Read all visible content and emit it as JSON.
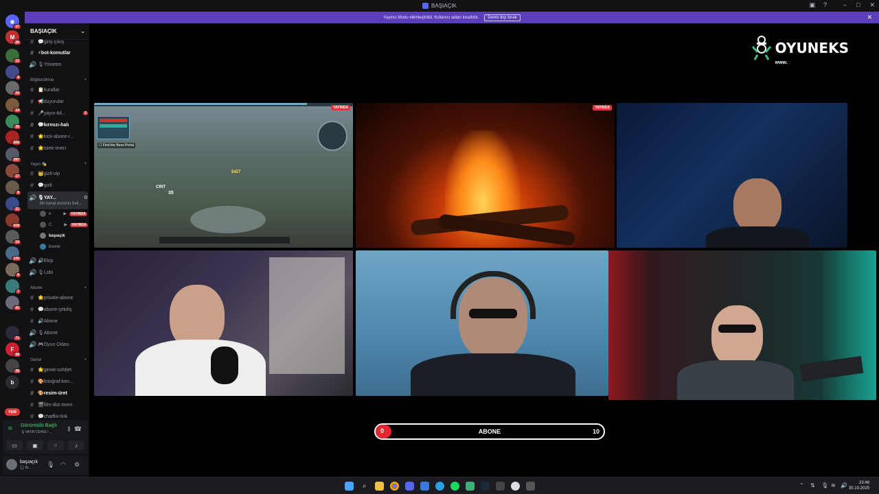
{
  "window": {
    "title": "BAŞIAÇIK"
  },
  "banner": {
    "text": "Yayıncı Modu etkinleştirildi. Kullanıcı adları kısaltıldı.",
    "button": "Devre dışı bırak"
  },
  "rail": {
    "badges": [
      "17",
      "26",
      "12",
      "8",
      "34",
      "14",
      "26",
      "506",
      "397",
      "17",
      "8",
      "21",
      "418",
      "14",
      "126",
      "8",
      "7",
      "41",
      "71",
      "68",
      "39",
      "YENİ"
    ],
    "letter": "b"
  },
  "sidebar": {
    "guild_name": "BAŞIAÇIK",
    "channels": [
      {
        "label": "💬giriş-çıkış"
      },
      {
        "label": "⚡bot-komutlar"
      },
      {
        "label": "🎙Yönetim"
      }
    ],
    "cat_bilgilendirme": "Bilgilendirme",
    "bilgi_channels": [
      {
        "label": "📋kurallar"
      },
      {
        "label": "📢duyurular"
      },
      {
        "label": "🎤yayın-bil...",
        "badge": "2"
      },
      {
        "label": "💬kırmızı-halı"
      },
      {
        "label": "🌟kick-abone-r..."
      },
      {
        "label": "🌟istek-öneri"
      }
    ],
    "cat_yayin": "Yayın 🎭",
    "yayin_channels": [
      {
        "label": "👑gizli-vip"
      },
      {
        "label": "💬gizli"
      },
      {
        "label": "🎙YAY..."
      }
    ],
    "active_sub": "Bir kanal durumu beli...",
    "voice_members": [
      {
        "name": "e",
        "tag": "YAYINDA"
      },
      {
        "name": "C",
        "tag": "YAYINDA"
      },
      {
        "name": "başıaçık",
        "tag": ""
      },
      {
        "name": "bsurer",
        "tag": ""
      }
    ],
    "more_channels": [
      {
        "label": "🔊Ekip"
      },
      {
        "label": "🎙Lobi"
      }
    ],
    "cat_abone": "Abone",
    "abone_channels": [
      {
        "label": "🌟private-abone"
      },
      {
        "label": "💬abone-çekiliş"
      },
      {
        "label": "🔊Abone"
      },
      {
        "label": "🎙Abone"
      },
      {
        "label": "🎮Oyun Odası"
      }
    ],
    "cat_genel": "Genel",
    "genel_channels": [
      {
        "label": "🌟genel-sohbet"
      },
      {
        "label": "🎨fotoğraf-ken..."
      },
      {
        "label": "🎨resim-üret"
      },
      {
        "label": "🎬film-dizi-öneri"
      },
      {
        "label": "💬chatflix-link"
      }
    ]
  },
  "voice_panel": {
    "status": "Görüntülü Bağlı",
    "channel": "🎙YAYIN ODASI / ..."
  },
  "user_panel": {
    "name": "başıaçık",
    "status": "🎧 Bi..."
  },
  "stage": {
    "tiles": [
      {
        "kind": "game",
        "live": "YAYINDA"
      },
      {
        "kind": "fireplace",
        "live": "YAYINDA"
      },
      {
        "kind": "webcam",
        "live": ""
      },
      {
        "kind": "webcam",
        "live": ""
      },
      {
        "kind": "webcam",
        "live": ""
      },
      {
        "kind": "webcam",
        "live": ""
      }
    ],
    "game_hud": {
      "quest": "Find the Boss Portal",
      "crit": "CRIT",
      "dmg1": "$427",
      "dmg2": "35"
    }
  },
  "logo": {
    "text": "OYUNEKS",
    "sub": "www."
  },
  "abone_goal": {
    "label": "ABONE",
    "current": "0",
    "max": "10",
    "progress": 0.07,
    "fill_color": "#e3262f"
  },
  "taskbar": {
    "time": "23:48",
    "date": "30.10.2025"
  }
}
